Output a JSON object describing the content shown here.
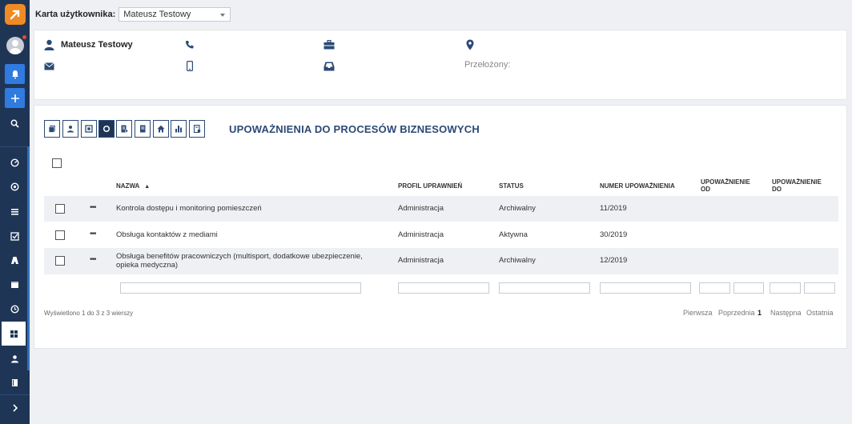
{
  "topbar": {
    "label": "Karta użytkownika:",
    "selected_user": "Mateusz Testowy"
  },
  "profile": {
    "name": "Mateusz Testowy",
    "supervisor_label": "Przełożony:"
  },
  "section": {
    "title": "UPOWAŻNIENIA DO PROCESÓW BIZNESOWYCH",
    "toolbar_icons": [
      "documents-icon",
      "user-icon",
      "badge-icon",
      "circle-icon",
      "list-check-icon",
      "document-icon",
      "home-icon",
      "bar-chart-icon",
      "report-icon"
    ],
    "active_toolbar_index": 3
  },
  "table": {
    "columns": {
      "name": "NAZWA",
      "profile": "PROFIL UPRAWNIEŃ",
      "status": "STATUS",
      "number": "NUMER UPOWAŻNIENIA",
      "from_l1": "UPOWAŻNIENIE",
      "from_l2": "OD",
      "to_l1": "UPOWAŻNIENIE",
      "to_l2": "DO"
    },
    "rows": [
      {
        "name": "Kontrola dostępu i monitoring pomieszczeń",
        "profile": "Administracja",
        "status": "Archiwalny",
        "number": "11/2019"
      },
      {
        "name": "Obsługa kontaktów z mediami",
        "profile": "Administracja",
        "status": "Aktywna",
        "number": "30/2019"
      },
      {
        "name": "Obsługa benefitów pracowniczych (multisport, dodatkowe ubezpieczenie, opieka medyczna)",
        "profile": "Administracja",
        "status": "Archiwalny",
        "number": "12/2019"
      }
    ],
    "row_menu": "•••"
  },
  "footer": {
    "info": "Wyświetlono 1 do 3 z 3 wierszy",
    "first": "Pierwsza",
    "prev": "Poprzednia",
    "page": "1",
    "next": "Następna",
    "last": "Ostatnia"
  },
  "colors": {
    "sidebar": "#1f3556",
    "accent": "#2f7be0",
    "logo": "#f08a24",
    "title": "#2b4a76"
  }
}
